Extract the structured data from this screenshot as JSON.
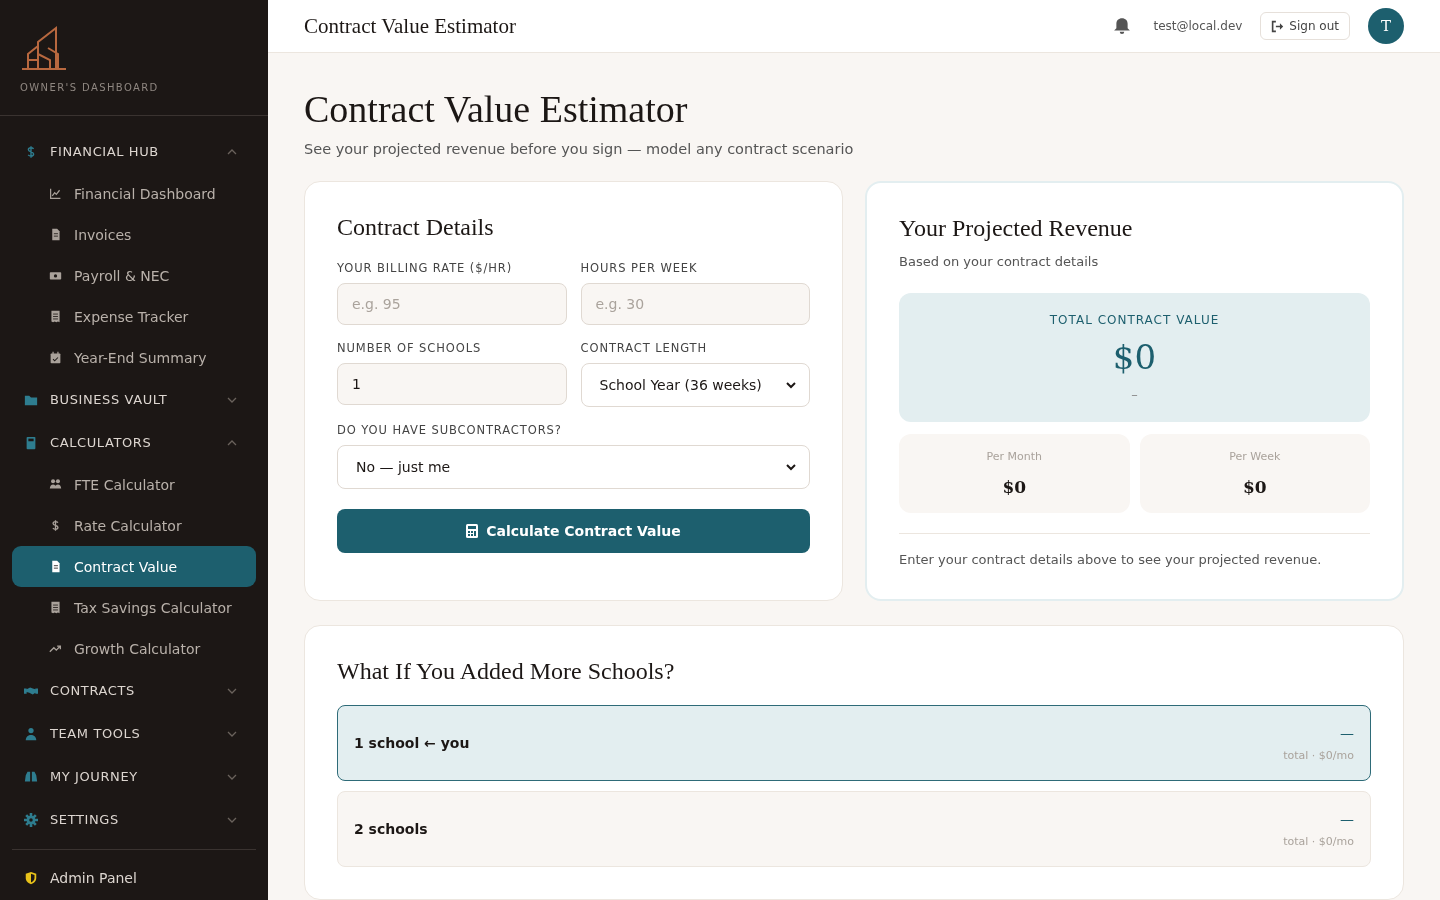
{
  "brand": {
    "name": "OWNER'S DASHBOARD"
  },
  "sidebar": {
    "sections": [
      {
        "label": "FINANCIAL HUB",
        "expanded": true,
        "items": [
          {
            "label": "Financial Dashboard",
            "selected": false
          },
          {
            "label": "Invoices",
            "selected": false
          },
          {
            "label": "Payroll & NEC",
            "selected": false
          },
          {
            "label": "Expense Tracker",
            "selected": false
          },
          {
            "label": "Year-End Summary",
            "selected": false
          }
        ]
      },
      {
        "label": "BUSINESS VAULT",
        "expanded": false
      },
      {
        "label": "CALCULATORS",
        "expanded": true,
        "items": [
          {
            "label": "FTE Calculator",
            "selected": false
          },
          {
            "label": "Rate Calculator",
            "selected": false
          },
          {
            "label": "Contract Value",
            "selected": true
          },
          {
            "label": "Tax Savings Calculator",
            "selected": false
          },
          {
            "label": "Growth Calculator",
            "selected": false
          }
        ]
      },
      {
        "label": "CONTRACTS",
        "expanded": false
      },
      {
        "label": "TEAM TOOLS",
        "expanded": false
      },
      {
        "label": "MY JOURNEY",
        "expanded": false
      },
      {
        "label": "SETTINGS",
        "expanded": false
      }
    ],
    "footer": {
      "label": "Admin Panel"
    }
  },
  "header": {
    "title": "Contract Value Estimator",
    "email": "test@local.dev",
    "sign_out": "Sign out",
    "avatar": "T"
  },
  "page": {
    "title": "Contract Value Estimator",
    "subtitle": "See your projected revenue before you sign — model any contract scenario"
  },
  "details": {
    "title": "Contract Details",
    "fields": [
      {
        "label": "YOUR BILLING RATE ($/HR)",
        "kind": "input",
        "placeholder": "e.g. 95"
      },
      {
        "label": "HOURS PER WEEK",
        "kind": "input",
        "placeholder": "e.g. 30"
      },
      {
        "label": "NUMBER OF SCHOOLS",
        "kind": "input",
        "value": "1"
      },
      {
        "label": "CONTRACT LENGTH",
        "kind": "select",
        "value": "School Year (36 weeks)"
      },
      {
        "label": "DO YOU HAVE SUBCONTRACTORS?",
        "kind": "select",
        "value": "No — just me"
      }
    ],
    "button": "Calculate Contract Value"
  },
  "revenue": {
    "title": "Your Projected Revenue",
    "subtitle": "Based on your contract details",
    "total_label": "TOTAL CONTRACT VALUE",
    "total": "$0",
    "total_note": "–",
    "stats": [
      {
        "label": "Per Month",
        "value": "$0"
      },
      {
        "label": "Per Week",
        "value": "$0"
      }
    ],
    "note": "Enter your contract details above to see your projected revenue."
  },
  "what_if": {
    "title": "What If You Added More Schools?",
    "rows": [
      {
        "label": "1 school ← you",
        "value": "—",
        "total": "total · $0/mo",
        "selected": true
      },
      {
        "label": "2 schools",
        "value": "—",
        "total": "total · $0/mo",
        "selected": false
      }
    ]
  }
}
